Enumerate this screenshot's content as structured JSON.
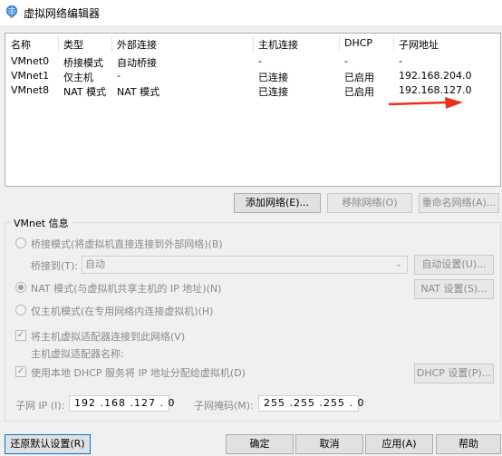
{
  "window": {
    "title": "虚拟网络编辑器",
    "icon": "network-globe-icon"
  },
  "network_table": {
    "columns": [
      "名称",
      "类型",
      "外部连接",
      "主机连接",
      "DHCP",
      "子网地址"
    ],
    "rows": [
      {
        "name": "VMnet0",
        "type": "桥接模式",
        "external": "自动桥接",
        "host": "-",
        "dhcp": "-",
        "subnet": "-"
      },
      {
        "name": "VMnet1",
        "type": "仅主机",
        "external": "-",
        "host": "已连接",
        "dhcp": "已启用",
        "subnet": "192.168.204.0"
      },
      {
        "name": "VMnet8",
        "type": "NAT 模式",
        "external": "NAT 模式",
        "host": "已连接",
        "dhcp": "已启用",
        "subnet": "192.168.127.0"
      }
    ]
  },
  "list_buttons": {
    "add": "添加网络(E)...",
    "remove": "移除网络(O)",
    "rename": "重命名网络(A)..."
  },
  "vmnet_info": {
    "group_title": "VMnet 信息",
    "bridged_label": "桥接模式(将虚拟机直接连接到外部网络)(B)",
    "bridged_to_label": "桥接到(T):",
    "bridged_to_value": "自动",
    "auto_settings": "自动设置(U)...",
    "nat_label": "NAT 模式(与虚拟机共享主机的 IP 地址)(N)",
    "nat_settings": "NAT 设置(S)...",
    "hostonly_label": "仅主机模式(在专用网络内连接虚拟机)(H)",
    "connect_adapter_label": "将主机虚拟适配器连接到此网络(V)",
    "adapter_name_label": "主机虚拟适配器名称:",
    "use_dhcp_label": "使用本地 DHCP 服务将 IP 地址分配给虚拟机(D)",
    "dhcp_settings": "DHCP 设置(P)...",
    "subnet_ip_label": "子网 IP (I):",
    "subnet_ip_value": "192 .168 .127 . 0",
    "subnet_mask_label": "子网掩码(M):",
    "subnet_mask_value": "255 .255 .255 . 0",
    "selected_mode": "nat",
    "connect_adapter_checked": true,
    "use_dhcp_checked": true
  },
  "footer": {
    "restore": "还原默认设置(R)",
    "ok": "确定",
    "cancel": "取消",
    "apply": "应用(A)",
    "help": "帮助"
  },
  "colors": {
    "annotation_arrow": "#f0301e",
    "focus_border": "#0078d7"
  }
}
